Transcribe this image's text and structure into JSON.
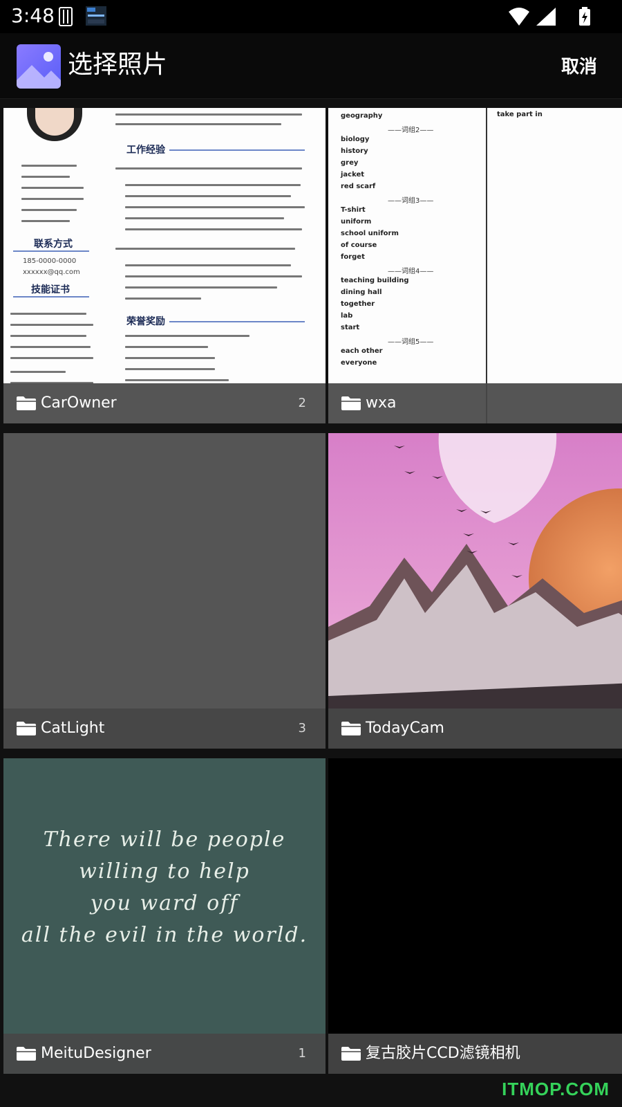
{
  "status_bar": {
    "time": "3:48",
    "icons": [
      "sim-card-icon",
      "app-notification-icon",
      "wifi-icon",
      "signal-icon",
      "battery-charging-icon"
    ]
  },
  "app_bar": {
    "title": "选择照片",
    "cancel_label": "取消",
    "logo_icon": "photo-app-logo"
  },
  "albums": [
    {
      "name": "CarOwner",
      "count": "2",
      "thumbnail": "resume-document"
    },
    {
      "name": "wxa",
      "count": "",
      "thumbnail": "vocabulary-document"
    },
    {
      "name": "CatLight",
      "count": "3",
      "thumbnail": "empty-gray"
    },
    {
      "name": "TodayCam",
      "count": "",
      "thumbnail": "moon-mountains-art"
    },
    {
      "name": "MeituDesigner",
      "count": "1",
      "thumbnail": "quote-chalkboard"
    },
    {
      "name": "复古胶片CCD滤镜相机",
      "count": "",
      "thumbnail": "black"
    }
  ],
  "quote_text": [
    "There will be people",
    "willing to help",
    "you ward off",
    "all the evil in the world."
  ],
  "resume": {
    "section_work": "工作经验",
    "section_contact": "联系方式",
    "section_skills": "技能证书",
    "section_awards": "荣誉奖励",
    "phone": "185-0000-0000",
    "email": "xxxxxx@qq.com"
  },
  "vocab": {
    "rows": [
      "geography",
      "biology",
      "history",
      "grey",
      "jacket",
      "red scarf",
      "T-shirt",
      "uniform",
      "school uniform",
      "of course",
      "forget",
      "teaching building",
      "dining hall",
      "together",
      "lab",
      "start",
      "each other",
      "everyone"
    ],
    "headers": [
      "——词组2——",
      "——词组3——",
      "——词组4——",
      "——词组5——"
    ],
    "side": "take part in"
  },
  "watermark": "ITMOP.COM",
  "colors": {
    "tile_placeholder": "#555555",
    "label_overlay": "#464646",
    "watermark": "#35d25a"
  }
}
